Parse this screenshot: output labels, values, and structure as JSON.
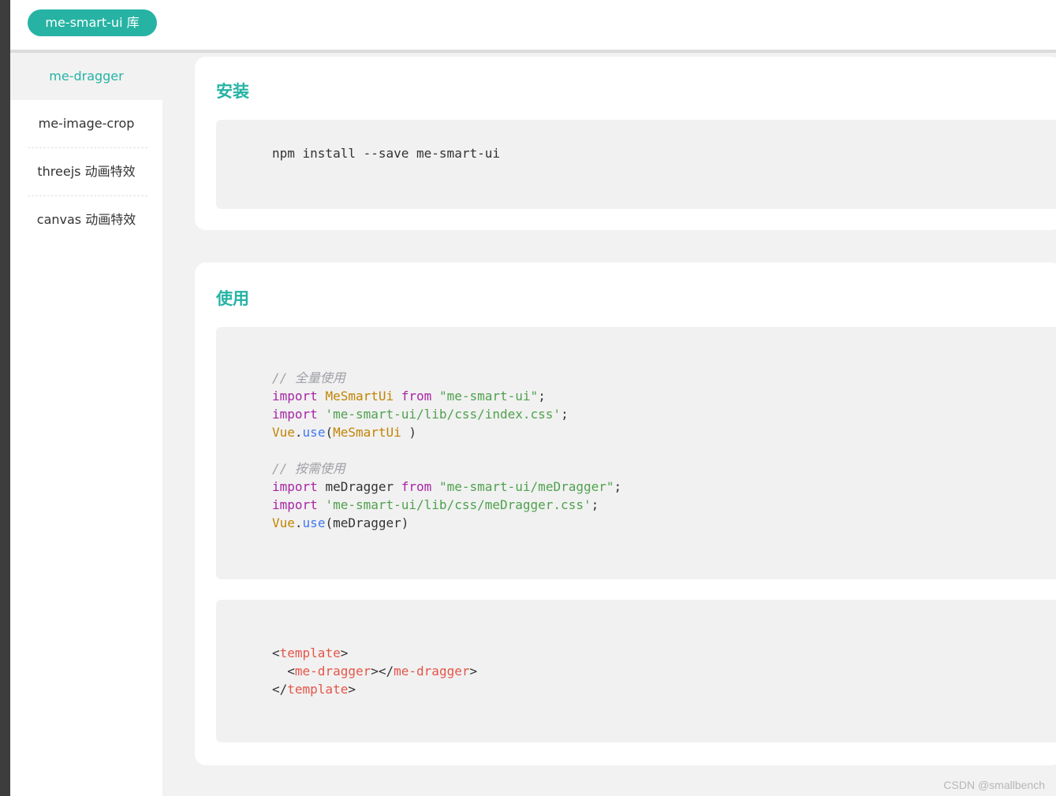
{
  "header": {
    "brand": "me-smart-ui 库"
  },
  "sidebar": {
    "items": [
      {
        "label": "me-dragger",
        "active": true
      },
      {
        "label": "me-image-crop",
        "active": false
      },
      {
        "label": "threejs 动画特效",
        "active": false
      },
      {
        "label": "canvas 动画特效",
        "active": false
      }
    ]
  },
  "install": {
    "title": "安装",
    "command": "npm install --save me-smart-ui"
  },
  "usage": {
    "title": "使用",
    "comment_full": "// 全量使用",
    "line1": {
      "kw1": "import",
      "name": "MeSmartUi",
      "kw2": "from",
      "src": "\"me-smart-ui\"",
      "end": ";"
    },
    "line2": {
      "kw1": "import",
      "src": "'me-smart-ui/lib/css/index.css'",
      "end": ";"
    },
    "line3": {
      "obj": "Vue",
      "dot": ".",
      "fn": "use",
      "open": "(",
      "arg": "MeSmartUi",
      "close": " )"
    },
    "comment_ondemand": "// 按需使用",
    "line4": {
      "kw1": "import",
      "name": "meDragger",
      "kw2": "from",
      "src": "\"me-smart-ui/meDragger\"",
      "end": ";"
    },
    "line5": {
      "kw1": "import",
      "src": "'me-smart-ui/lib/css/meDragger.css'",
      "end": ";"
    },
    "line6": {
      "obj": "Vue",
      "dot": ".",
      "fn": "use",
      "open": "(",
      "arg": "meDragger",
      "close": ")"
    },
    "template": {
      "lt1": "<",
      "tag1": "template",
      "gt1": ">",
      "indent": "  ",
      "lt2": "<",
      "tag2": "me-dragger",
      "mid": "></",
      "tag3": "me-dragger",
      "gt2": ">",
      "lt3": "</",
      "tag4": "template",
      "gt3": ">"
    }
  },
  "watermark": "CSDN @smallbench",
  "colors": {
    "accent": "#26b3a4",
    "keyword": "#a626a4",
    "class": "#c18401",
    "string": "#50a14f",
    "function": "#4078f2",
    "comment": "#a0a1a7",
    "tag": "#e45649"
  }
}
